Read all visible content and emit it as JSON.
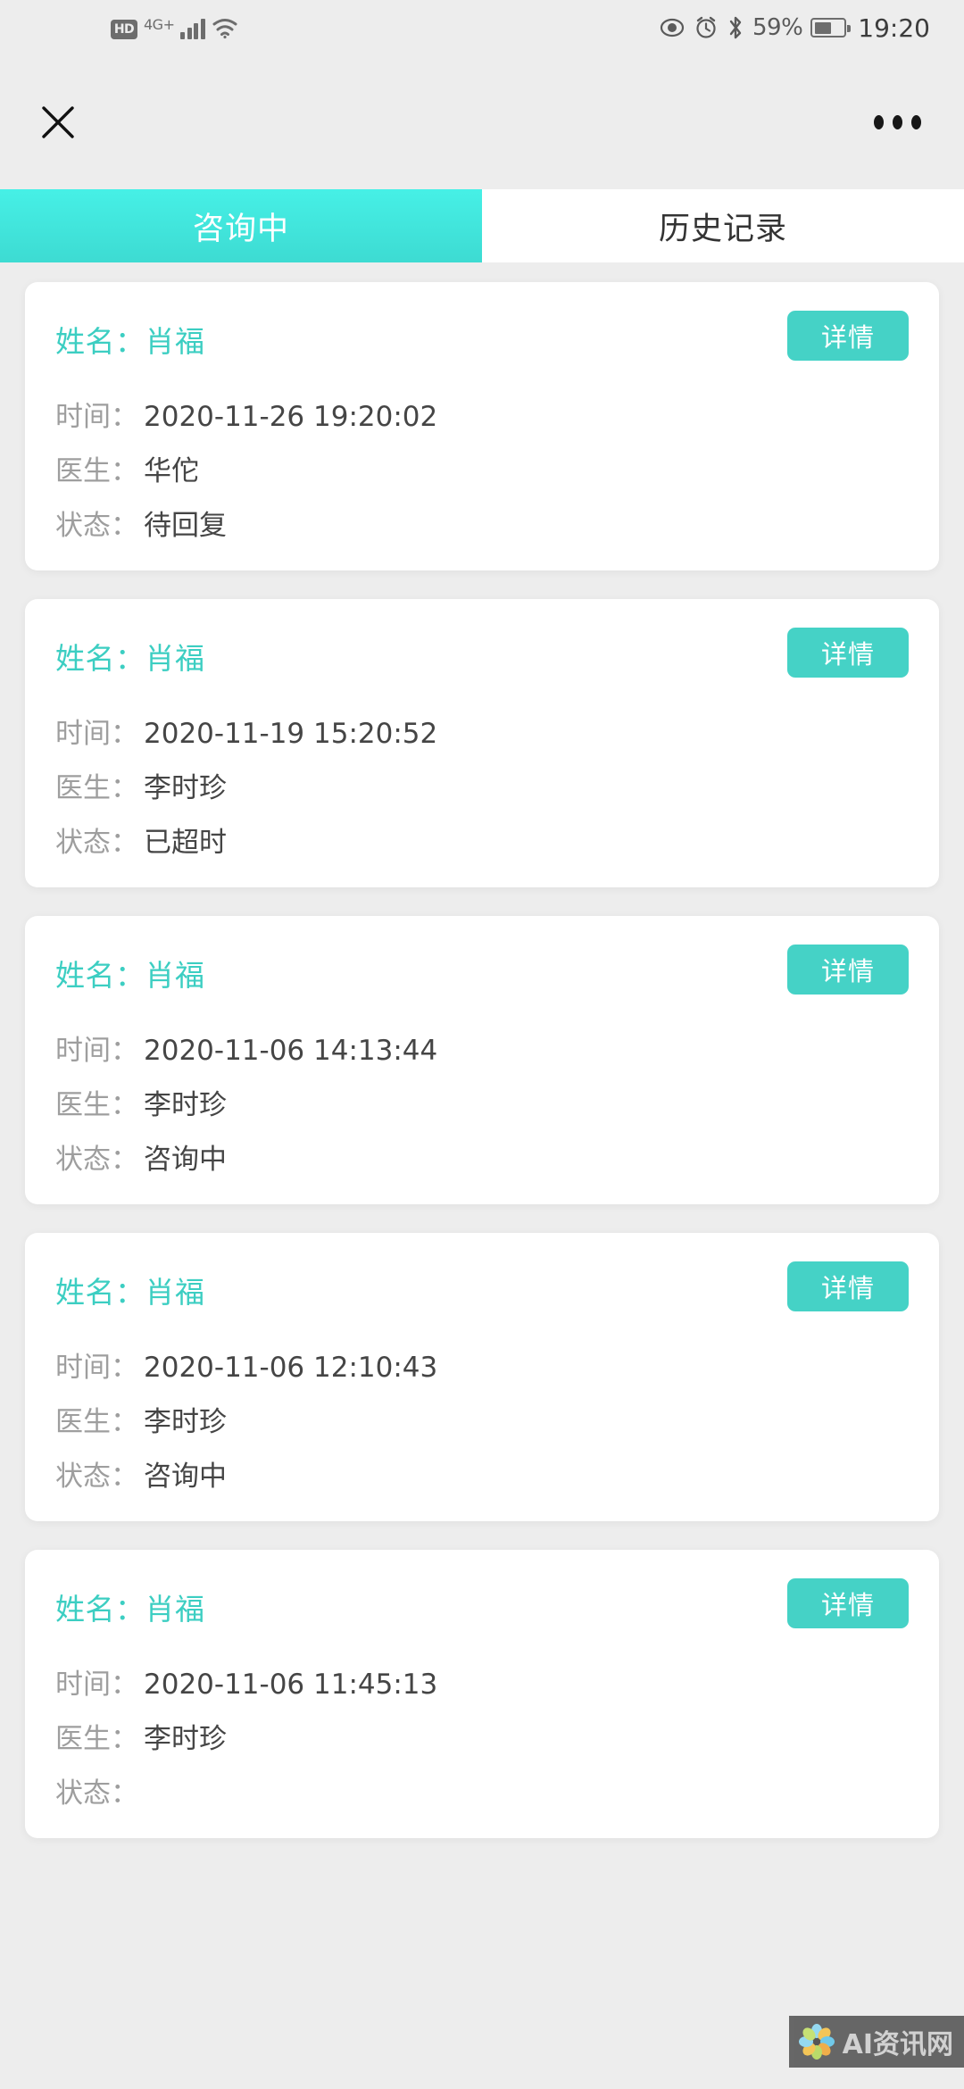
{
  "status_bar": {
    "hd_label": "HD",
    "network_label": "4G+",
    "signal_icon": "signal-bars-icon",
    "wifi_icon": "wifi-icon",
    "eye_icon": "eye-icon",
    "alarm_icon": "alarm-clock-icon",
    "bluetooth_icon": "bluetooth-icon",
    "battery_percent": "59%",
    "battery_icon": "battery-icon",
    "time": "19:20"
  },
  "nav": {
    "close_icon": "close-icon",
    "more_icon": "more-options-icon"
  },
  "tabs": [
    {
      "label": "咨询中",
      "active": true
    },
    {
      "label": "历史记录",
      "active": false
    }
  ],
  "labels": {
    "name": "姓名：",
    "time": "时间：",
    "doctor": "医生：",
    "status": "状态：",
    "detail_button": "详情"
  },
  "colors": {
    "accent": "#3ccec2",
    "tab_active_bg": "#46f0e6",
    "button_bg": "#45d2c6",
    "label_gray": "#9e9e9e",
    "value_gray": "#454545",
    "page_bg": "#ededed"
  },
  "cards": [
    {
      "name": "肖福",
      "time": "2020-11-26 19:20:02",
      "doctor": "华佗",
      "status": "待回复"
    },
    {
      "name": "肖福",
      "time": "2020-11-19 15:20:52",
      "doctor": "李时珍",
      "status": "已超时"
    },
    {
      "name": "肖福",
      "time": "2020-11-06 14:13:44",
      "doctor": "李时珍",
      "status": "咨询中"
    },
    {
      "name": "肖福",
      "time": "2020-11-06 12:10:43",
      "doctor": "李时珍",
      "status": "咨询中"
    },
    {
      "name": "肖福",
      "time": "2020-11-06 11:45:13",
      "doctor": "李时珍",
      "status": ""
    }
  ],
  "watermark": {
    "text": "AI资讯网",
    "logo_icon": "flower-logo-icon"
  }
}
